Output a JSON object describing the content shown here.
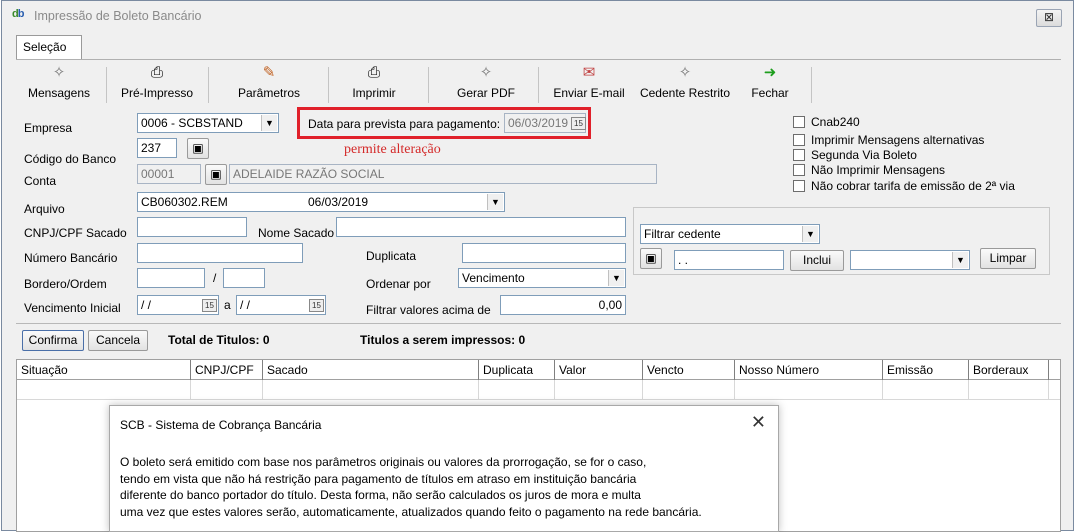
{
  "window": {
    "title": "Impressão de Boleto Bancário",
    "close_symbol": "⊠"
  },
  "tabs": [
    {
      "label": "Seleção"
    }
  ],
  "toolbar": {
    "items": [
      {
        "label": "Mensagens",
        "icon": "envelope-icon"
      },
      {
        "label": "Pré-Impresso",
        "icon": "printer-icon"
      },
      {
        "label": "Parâmetros",
        "icon": "pencil-icon"
      },
      {
        "label": "Imprimir",
        "icon": "printer-icon"
      },
      {
        "label": "Gerar PDF",
        "icon": "envelope-icon"
      },
      {
        "label": "Enviar E-mail",
        "icon": "mail-send-icon"
      },
      {
        "label": "Cedente Restrito",
        "icon": "envelope-icon"
      },
      {
        "label": "Fechar",
        "icon": "green-arrow-icon"
      }
    ]
  },
  "form": {
    "empresa_label": "Empresa",
    "empresa_value": "0006 - SCBSTAND",
    "codigo_banco_label": "Código do Banco",
    "codigo_banco_value": "237",
    "conta_label": "Conta",
    "conta_value": "00001",
    "conta_nome": "ADELAIDE RAZÃO SOCIAL",
    "arquivo_label": "Arquivo",
    "arquivo_value": "CB060302.REM",
    "arquivo_date": "06/03/2019",
    "data_prevista_label": "Data para  prevista para pagamento:",
    "data_prevista_value": "06/03/2019",
    "note": "permite alteração",
    "cnpj_label": "CNPJ/CPF Sacado",
    "cnpj_value": "",
    "nome_sacado_label": "Nome Sacado",
    "nome_sacado_value": "",
    "numero_bancario_label": "Número Bancário",
    "numero_bancario_value": "",
    "duplicata_label": "Duplicata",
    "duplicata_value": "",
    "bordero_label": "Bordero/Ordem",
    "bordero_sep": "/",
    "ordenar_label": "Ordenar por",
    "ordenar_value": "Vencimento",
    "venc_label": "Vencimento Inicial",
    "venc_from": "/ /",
    "venc_a": "a",
    "venc_to": "/ /",
    "filtrar_label": "Filtrar valores acima de",
    "filtrar_value": "0,00",
    "cal_glyph": "15",
    "dd_glyph": "▼",
    "search_glyph": "▣"
  },
  "checkboxes": [
    {
      "label": "Cnab240",
      "checked": false
    },
    {
      "label": "Imprimir Mensagens alternativas",
      "checked": false
    },
    {
      "label": "Segunda Via Boleto",
      "checked": false
    },
    {
      "label": "Não Imprimir Mensagens",
      "checked": false
    },
    {
      "label": "Não cobrar tarifa de emissão de 2ª via",
      "checked": false
    }
  ],
  "cedente": {
    "filter_value": "Filtrar cedente",
    "code_value": ". .",
    "inclui_label": "Inclui",
    "limpar_label": "Limpar",
    "combo_value": ""
  },
  "actions": {
    "confirma_label": "Confirma",
    "cancela_label": "Cancela",
    "total_label": "Total de Titulos: 0",
    "impressos_label": "Titulos a serem impressos: 0"
  },
  "grid": {
    "columns": [
      "Situação",
      "CNPJ/CPF",
      "Sacado",
      "Duplicata",
      "Valor",
      "Vencto",
      "Nosso Número",
      "Emissão",
      "Borderaux"
    ]
  },
  "dialog": {
    "title": "SCB - Sistema de Cobrança Bancária",
    "close_symbol": "✕",
    "lines": [
      "O boleto será emitido com base nos parâmetros originais ou valores da prorrogação, se for o caso,",
      "tendo em vista que não há restrição para pagamento de títulos em atraso  em instituição  bancária",
      "diferente do banco portador do título. Desta forma, não serão calculados os juros de mora e multa",
      "uma vez que estes valores serão, automaticamente, atualizados quando feito o pagamento na rede bancária."
    ]
  }
}
